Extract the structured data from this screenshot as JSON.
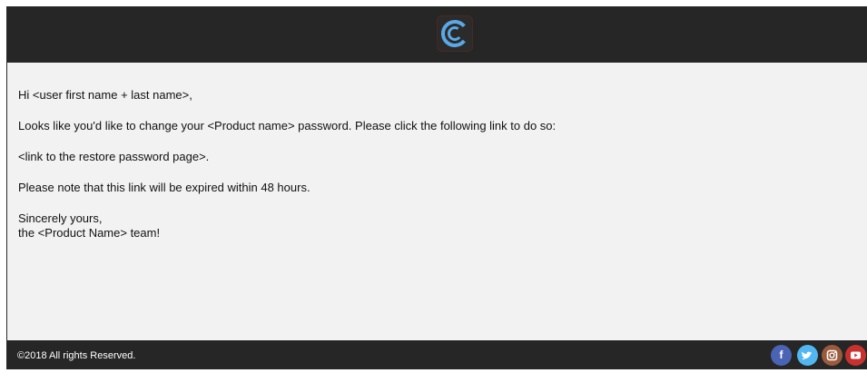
{
  "header": {
    "logo_icon": "c-logo-icon"
  },
  "email": {
    "greeting": "Hi <user first name + last name>,",
    "line1": "Looks like you'd like to change your <Product name> password. Please click the following link to do so:",
    "link": "<link to the restore password page>.",
    "note": "Please note that this link will be expired within 48 hours.",
    "signoff1": "Sincerely yours,",
    "signoff2": "the <Product Name> team!"
  },
  "footer": {
    "copyright": "©2018  All rights Reserved.",
    "social": [
      {
        "name": "facebook-icon",
        "glyph": "f",
        "color": "#4a63b3"
      },
      {
        "name": "twitter-icon",
        "glyph": "t",
        "color": "#52b6f0"
      },
      {
        "name": "instagram-icon",
        "glyph": "◘",
        "color": "#9a5b3d"
      },
      {
        "name": "youtube-icon",
        "glyph": "▶",
        "color": "#c8322e"
      }
    ]
  }
}
